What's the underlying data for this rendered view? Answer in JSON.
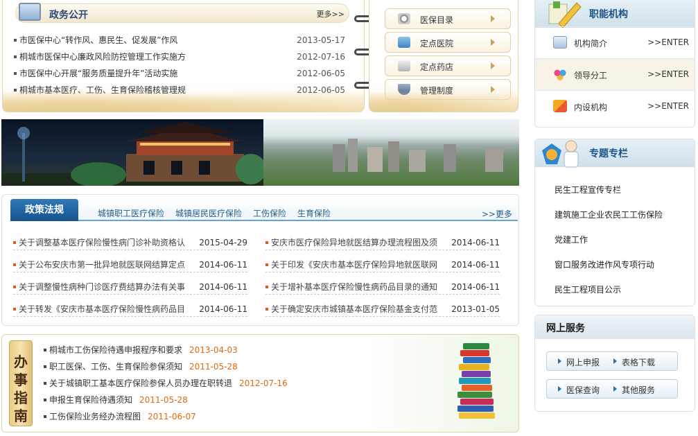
{
  "affairs": {
    "title": "政务公开",
    "more": "更多>>",
    "items": [
      {
        "title": "市医保中心“转作风、惠民生、促发展”作风",
        "date": "2013-05-17"
      },
      {
        "title": "桐城市医保中心廉政风险防控管理工作实施方",
        "date": "2012-07-16"
      },
      {
        "title": "市医保中心开展“服务质量提升年”活动实施",
        "date": "2012-06-05"
      },
      {
        "title": "桐城市基本医疗、工伤、生育保险稽核管理规",
        "date": "2012-06-05"
      }
    ]
  },
  "quick_links": [
    {
      "label": "医保目录",
      "icon": "clock-icon"
    },
    {
      "label": "定点医院",
      "icon": "hospital-icon"
    },
    {
      "label": "定点药店",
      "icon": "store-icon"
    },
    {
      "label": "管理制度",
      "icon": "shield-icon"
    }
  ],
  "policy": {
    "active_tab": "政策法规",
    "tabs": [
      "城镇职工医疗保险",
      "城镇居民医疗保险",
      "工伤保险",
      "生育保险"
    ],
    "more": ">>更多",
    "left": [
      {
        "title": "关于调整基本医疗保险慢性病门诊补助资格认",
        "date": "2015-04-29"
      },
      {
        "title": "关于公布安庆市第一批异地就医联网结算定点",
        "date": "2014-06-11"
      },
      {
        "title": "关于调整慢性病种门诊医疗费结算办法有关事",
        "date": "2014-06-11"
      },
      {
        "title": "关于转发《安庆市基本医疗保险慢性病药品目",
        "date": "2014-06-11"
      }
    ],
    "right": [
      {
        "title": "安庆市医疗保险异地就医结算办理流程图及须",
        "date": "2014-06-11"
      },
      {
        "title": "关于印发《安庆市基本医疗保险异地就医联网",
        "date": "2014-06-11"
      },
      {
        "title": "关于增补基本医疗保险慢性病药品目录的通知",
        "date": "2014-06-11"
      },
      {
        "title": "关于确定安庆市城镇基本医疗保险基金支付范",
        "date": "2013-01-05"
      }
    ]
  },
  "guide": {
    "scroll_chars": [
      "办",
      "事",
      "指",
      "南"
    ],
    "items": [
      {
        "title": "桐城市工伤保险待遇申报程序和要求",
        "date": "2013-04-03"
      },
      {
        "title": "职工医保、工伤、生育保险参保须知",
        "date": "2011-05-28"
      },
      {
        "title": "关于城镇职工基本医疗保险参保人员办理在职转退",
        "date": "2012-07-16"
      },
      {
        "title": "申报生育保险待遇须知",
        "date": "2011-05-28"
      },
      {
        "title": "工伤保险业务经办流程图",
        "date": "2011-06-07"
      }
    ]
  },
  "org": {
    "title": "职能机构",
    "items": [
      {
        "label": "机构简介",
        "enter": ">>ENTER"
      },
      {
        "label": "领导分工",
        "enter": ">>ENTER"
      },
      {
        "label": "内设机构",
        "enter": ">>ENTER"
      }
    ]
  },
  "topics": {
    "title": "专题专栏",
    "items": [
      "民生工程宣传专栏",
      "建筑施工企业农民工工伤保险",
      "党建工作",
      "窗口服务改进作风专项行动",
      "民生工程项目公示"
    ]
  },
  "online": {
    "title": "网上服务",
    "buttons": [
      [
        "网上申报",
        "表格下载"
      ],
      [
        "医保查询",
        "其他服务"
      ]
    ]
  },
  "colors": {
    "brand_blue": "#1d5486",
    "date_orange": "#e06a10",
    "accent_orange": "#e05a1e"
  }
}
